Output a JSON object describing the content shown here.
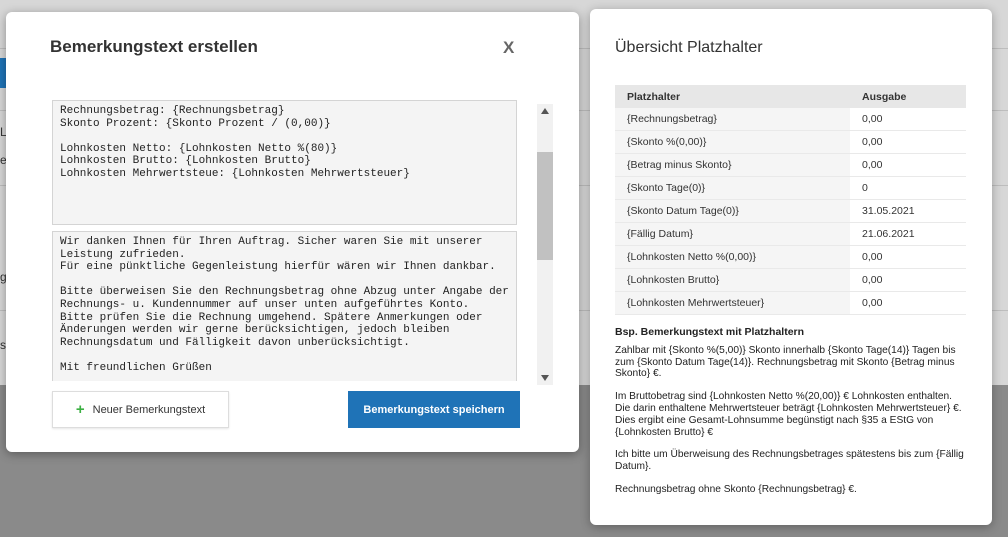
{
  "background": {
    "glyphs": [
      "L",
      "e",
      "g",
      "s"
    ]
  },
  "modal": {
    "title": "Bemerkungstext erstellen",
    "close_label": "X",
    "editor_top": "Rechnungsbetrag: {Rechnungsbetrag}\nSkonto Prozent: {Skonto Prozent / (0,00)}\n\nLohnkosten Netto: {Lohnkosten Netto %(80)}\nLohnkosten Brutto: {Lohnkosten Brutto}\nLohnkosten Mehrwertsteue: {Lohnkosten Mehrwertsteuer}",
    "editor_bottom": "Wir danken Ihnen für Ihren Auftrag. Sicher waren Sie mit unserer Leistung zufrieden.\nFür eine pünktliche Gegenleistung hierfür wären wir Ihnen dankbar.\n\nBitte überweisen Sie den Rechnungsbetrag ohne Abzug unter Angabe der Rechnungs- u. Kundennummer auf unser unten aufgeführtes Konto.\nBitte prüfen Sie die Rechnung umgehend. Spätere Anmerkungen oder Änderungen werden wir gerne berücksichtigen, jedoch bleiben Rechnungsdatum und Fälligkeit davon unberücksichtigt.\n\nMit freundlichen Grüßen",
    "new_button_label": "Neuer Bemerkungstext",
    "save_button_label": "Bemerkungstext speichern",
    "colors": {
      "primary": "#1f73b7",
      "plus": "#3cb043"
    }
  },
  "panel": {
    "title": "Übersicht Platzhalter",
    "columns": [
      "Platzhalter",
      "Ausgabe"
    ],
    "rows": [
      {
        "name": "{Rechnungsbetrag}",
        "value": "0,00"
      },
      {
        "name": "{Skonto %(0,00)}",
        "value": "0,00"
      },
      {
        "name": "{Betrag minus Skonto}",
        "value": "0,00"
      },
      {
        "name": "{Skonto Tage(0)}",
        "value": "0"
      },
      {
        "name": "{Skonto Datum Tage(0)}",
        "value": "31.05.2021"
      },
      {
        "name": "{Fällig Datum}",
        "value": "21.06.2021"
      },
      {
        "name": "{Lohnkosten Netto %(0,00)}",
        "value": "0,00"
      },
      {
        "name": "{Lohnkosten Brutto}",
        "value": "0,00"
      },
      {
        "name": "{Lohnkosten Mehrwertsteuer}",
        "value": "0,00"
      }
    ],
    "example_title": "Bsp. Bemerkungstext mit Platzhaltern",
    "example_paragraphs": [
      "Zahlbar mit {Skonto %(5,00)} Skonto innerhalb {Skonto Tage(14)} Tagen bis zum {Skonto Datum Tage(14)}. Rechnungsbetrag mit Skonto {Betrag minus Skonto} €.",
      "Im Bruttobetrag sind {Lohnkosten Netto %(20,00)} € Lohnkosten enthalten. Die darin enthaltene Mehrwertsteuer beträgt {Lohnkosten Mehrwertsteuer} €. Dies ergibt eine Gesamt-Lohnsumme begünstigt nach §35 a EStG von {Lohnkosten Brutto} €",
      "Ich bitte um Überweisung des Rechnungsbetrages spätestens bis zum {Fällig Datum}.",
      "Rechnungsbetrag ohne Skonto {Rechnungsbetrag} €."
    ]
  }
}
